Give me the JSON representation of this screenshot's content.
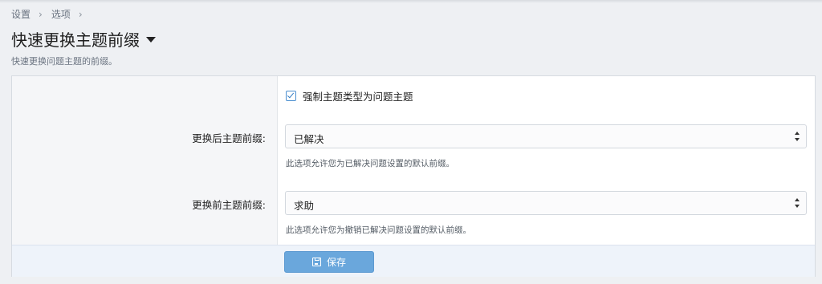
{
  "breadcrumb": {
    "items": [
      "设置",
      "选项"
    ],
    "separator": "›"
  },
  "page": {
    "title": "快速更换主题前缀",
    "description": "快速更换问题主题的前缀。"
  },
  "form": {
    "force_type": {
      "label": "强制主题类型为问题主题",
      "checked": true
    },
    "after_prefix": {
      "label": "更换后主题前缀:",
      "value": "已解决",
      "hint": "此选项允许您为已解决问题设置的默认前缀。"
    },
    "before_prefix": {
      "label": "更换前主题前缀:",
      "value": "求助",
      "hint": "此选项允许您为撤销已解决问题设置的默认前缀。"
    }
  },
  "footer": {
    "save_label": "保存"
  },
  "colors": {
    "accent": "#6aa7dc",
    "checkbox": "#2f7ac4",
    "background": "#eef0f3"
  }
}
